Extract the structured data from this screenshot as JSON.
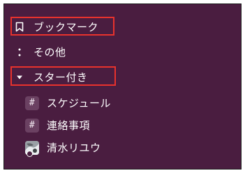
{
  "sidebar": {
    "bookmarks": {
      "label": "ブックマーク",
      "icon": "bookmark-icon"
    },
    "more": {
      "label": "その他",
      "icon": "vertical-ellipsis-icon"
    },
    "starred_section": {
      "label": "スター付き",
      "icon": "caret-down-icon"
    },
    "starred_items": [
      {
        "label": "スケジュール",
        "icon": "hash-icon"
      },
      {
        "label": "連絡事項",
        "icon": "hash-icon"
      },
      {
        "label": "清水リユウ",
        "icon": "user-avatar"
      }
    ]
  },
  "colors": {
    "sidebar_bg": "#4a1d40",
    "highlight_border": "#e8322d",
    "text": "#ffffff"
  }
}
